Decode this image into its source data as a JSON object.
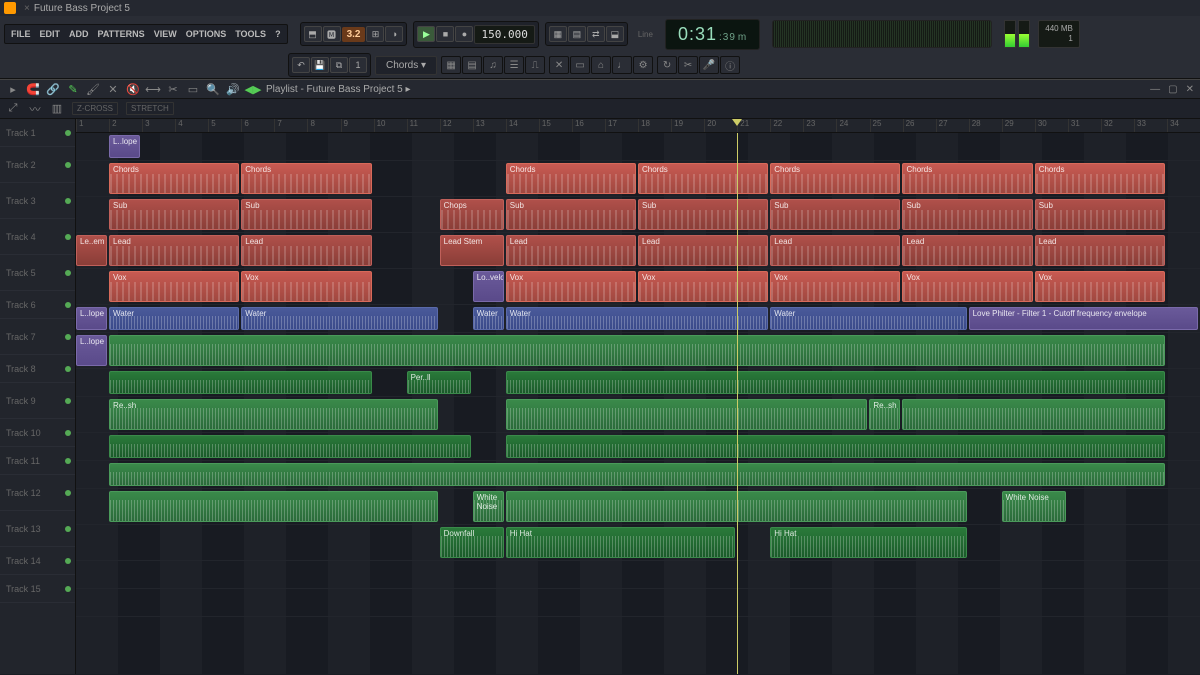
{
  "app": {
    "project_title": "Future Bass Project 5",
    "playlist_title": "Playlist - Future Bass Project 5 ▸"
  },
  "menu": [
    "FILE",
    "EDIT",
    "ADD",
    "PATTERNS",
    "VIEW",
    "OPTIONS",
    "TOOLS",
    "?"
  ],
  "transport": {
    "pattern_num": "3.2",
    "tempo": "150.000",
    "time_main": "0:31",
    "time_sub": ":39",
    "time_suffix": "m",
    "mem": "440 MB",
    "cpu": "1",
    "snap_mode": "Line"
  },
  "pattern_picker": "Chords",
  "snap_labels": {
    "zcross": "Z-CROSS",
    "stretch": "STRETCH"
  },
  "bars": [
    "1",
    "2",
    "3",
    "4",
    "5",
    "6",
    "7",
    "8",
    "9",
    "10",
    "11",
    "12",
    "13",
    "14",
    "15",
    "16",
    "17",
    "18",
    "19",
    "20",
    "21",
    "22",
    "23",
    "24",
    "25",
    "26",
    "27",
    "28",
    "29",
    "30",
    "31",
    "32",
    "33",
    "34"
  ],
  "playhead_bar": 21,
  "tracks": [
    {
      "name": "Track 1",
      "h": "short",
      "clips": [
        {
          "label": "L..lope",
          "cls": "purple",
          "start": 1,
          "len": 1
        }
      ]
    },
    {
      "name": "Track 2",
      "h": "",
      "clips": [
        {
          "label": "Chords",
          "cls": "red",
          "start": 1,
          "len": 4,
          "notes": true
        },
        {
          "label": "Chords",
          "cls": "red",
          "start": 5,
          "len": 4,
          "notes": true
        },
        {
          "label": "Chords",
          "cls": "red",
          "start": 13,
          "len": 4,
          "notes": true
        },
        {
          "label": "Chords",
          "cls": "red",
          "start": 17,
          "len": 4,
          "notes": true
        },
        {
          "label": "Chords",
          "cls": "red",
          "start": 21,
          "len": 4,
          "notes": true
        },
        {
          "label": "Chords",
          "cls": "red",
          "start": 25,
          "len": 4,
          "notes": true
        },
        {
          "label": "Chords",
          "cls": "red",
          "start": 29,
          "len": 4,
          "notes": true
        }
      ]
    },
    {
      "name": "Track 3",
      "h": "",
      "clips": [
        {
          "label": "Sub",
          "cls": "red2",
          "start": 1,
          "len": 4,
          "notes": true
        },
        {
          "label": "Sub",
          "cls": "red2",
          "start": 5,
          "len": 4,
          "notes": true
        },
        {
          "label": "Chops",
          "cls": "red2",
          "start": 11,
          "len": 2,
          "notes": true
        },
        {
          "label": "Sub",
          "cls": "red2",
          "start": 13,
          "len": 4,
          "notes": true
        },
        {
          "label": "Sub",
          "cls": "red2",
          "start": 17,
          "len": 4,
          "notes": true
        },
        {
          "label": "Sub",
          "cls": "red2",
          "start": 21,
          "len": 4,
          "notes": true
        },
        {
          "label": "Sub",
          "cls": "red2",
          "start": 25,
          "len": 4,
          "notes": true
        },
        {
          "label": "Sub",
          "cls": "red2",
          "start": 29,
          "len": 4,
          "notes": true
        }
      ]
    },
    {
      "name": "Track 4",
      "h": "",
      "clips": [
        {
          "label": "Le..em",
          "cls": "red2",
          "start": 0,
          "len": 1
        },
        {
          "label": "Lead",
          "cls": "red2",
          "start": 1,
          "len": 4,
          "notes": true
        },
        {
          "label": "Lead",
          "cls": "red2",
          "start": 5,
          "len": 4,
          "notes": true
        },
        {
          "label": "Lead Stem",
          "cls": "red2",
          "start": 11,
          "len": 2
        },
        {
          "label": "Lead",
          "cls": "red2",
          "start": 13,
          "len": 4,
          "notes": true
        },
        {
          "label": "Lead",
          "cls": "red2",
          "start": 17,
          "len": 4,
          "notes": true
        },
        {
          "label": "Lead",
          "cls": "red2",
          "start": 21,
          "len": 4,
          "notes": true
        },
        {
          "label": "Lead",
          "cls": "red2",
          "start": 25,
          "len": 4,
          "notes": true
        },
        {
          "label": "Lead",
          "cls": "red2",
          "start": 29,
          "len": 4,
          "notes": true
        }
      ]
    },
    {
      "name": "Track 5",
      "h": "",
      "clips": [
        {
          "label": "Vox",
          "cls": "red",
          "start": 1,
          "len": 4,
          "notes": true
        },
        {
          "label": "Vox",
          "cls": "red",
          "start": 5,
          "len": 4,
          "notes": true
        },
        {
          "label": "Lo..velope",
          "cls": "purple",
          "start": 12,
          "len": 1
        },
        {
          "label": "Vox",
          "cls": "red",
          "start": 13,
          "len": 4,
          "notes": true
        },
        {
          "label": "Vox",
          "cls": "red",
          "start": 17,
          "len": 4,
          "notes": true
        },
        {
          "label": "Vox",
          "cls": "red",
          "start": 21,
          "len": 4,
          "notes": true
        },
        {
          "label": "Vox",
          "cls": "red",
          "start": 25,
          "len": 4,
          "notes": true
        },
        {
          "label": "Vox",
          "cls": "red",
          "start": 29,
          "len": 4,
          "notes": true
        }
      ]
    },
    {
      "name": "Track 6",
      "h": "short",
      "clips": [
        {
          "label": "L..lope",
          "cls": "purple",
          "start": 0,
          "len": 1
        },
        {
          "label": "Water",
          "cls": "blue",
          "start": 1,
          "len": 4,
          "wf": true
        },
        {
          "label": "Water",
          "cls": "blue",
          "start": 5,
          "len": 6,
          "wf": true
        },
        {
          "label": "Water",
          "cls": "blue",
          "start": 12,
          "len": 1,
          "wf": true
        },
        {
          "label": "Water",
          "cls": "blue",
          "start": 13,
          "len": 8,
          "wf": true
        },
        {
          "label": "Water",
          "cls": "blue",
          "start": 21,
          "len": 6,
          "wf": true
        },
        {
          "label": "Love Philter - Filter 1 - Cutoff frequency envelope",
          "cls": "purple",
          "start": 27,
          "len": 7
        }
      ]
    },
    {
      "name": "Track 7",
      "h": "",
      "clips": [
        {
          "label": "L..lope",
          "cls": "purple",
          "start": 0,
          "len": 1
        },
        {
          "label": "",
          "cls": "green",
          "start": 1,
          "len": 32,
          "wf": true
        }
      ]
    },
    {
      "name": "Track 8",
      "h": "short",
      "clips": [
        {
          "label": "",
          "cls": "green2",
          "start": 1,
          "len": 8,
          "wf": true
        },
        {
          "label": "Per..ll",
          "cls": "green2",
          "start": 10,
          "len": 2,
          "wf": true
        },
        {
          "label": "",
          "cls": "green2",
          "start": 13,
          "len": 20,
          "wf": true
        }
      ]
    },
    {
      "name": "Track 9",
      "h": "",
      "clips": [
        {
          "label": "Re..sh",
          "cls": "green",
          "start": 1,
          "len": 10,
          "wf": true
        },
        {
          "label": "",
          "cls": "green",
          "start": 13,
          "len": 11,
          "wf": true
        },
        {
          "label": "Re..sh",
          "cls": "green",
          "start": 24,
          "len": 1,
          "wf": true
        },
        {
          "label": "",
          "cls": "green",
          "start": 25,
          "len": 8,
          "wf": true
        }
      ]
    },
    {
      "name": "Track 10",
      "h": "short",
      "clips": [
        {
          "label": "",
          "cls": "green2",
          "start": 1,
          "len": 11,
          "wf": true
        },
        {
          "label": "",
          "cls": "green2",
          "start": 13,
          "len": 20,
          "wf": true
        }
      ]
    },
    {
      "name": "Track 11",
      "h": "short",
      "clips": [
        {
          "label": "",
          "cls": "green",
          "start": 1,
          "len": 32,
          "wf": true
        }
      ]
    },
    {
      "name": "Track 12",
      "h": "",
      "clips": [
        {
          "label": "",
          "cls": "green",
          "start": 1,
          "len": 10,
          "wf": true
        },
        {
          "label": "White Noise",
          "cls": "green",
          "start": 12,
          "len": 1,
          "wf": true
        },
        {
          "label": "",
          "cls": "green",
          "start": 13,
          "len": 14,
          "wf": true
        },
        {
          "label": "White Noise",
          "cls": "green",
          "start": 28,
          "len": 2,
          "wf": true
        }
      ]
    },
    {
      "name": "Track 13",
      "h": "",
      "clips": [
        {
          "label": "Downfall",
          "cls": "green2",
          "start": 11,
          "len": 2,
          "wf": true
        },
        {
          "label": "Hi Hat",
          "cls": "green2",
          "start": 13,
          "len": 7,
          "wf": true
        },
        {
          "label": "Hi Hat",
          "cls": "green2",
          "start": 21,
          "len": 6,
          "wf": true
        }
      ]
    },
    {
      "name": "Track 14",
      "h": "short",
      "clips": []
    },
    {
      "name": "Track 15",
      "h": "short",
      "clips": []
    }
  ]
}
